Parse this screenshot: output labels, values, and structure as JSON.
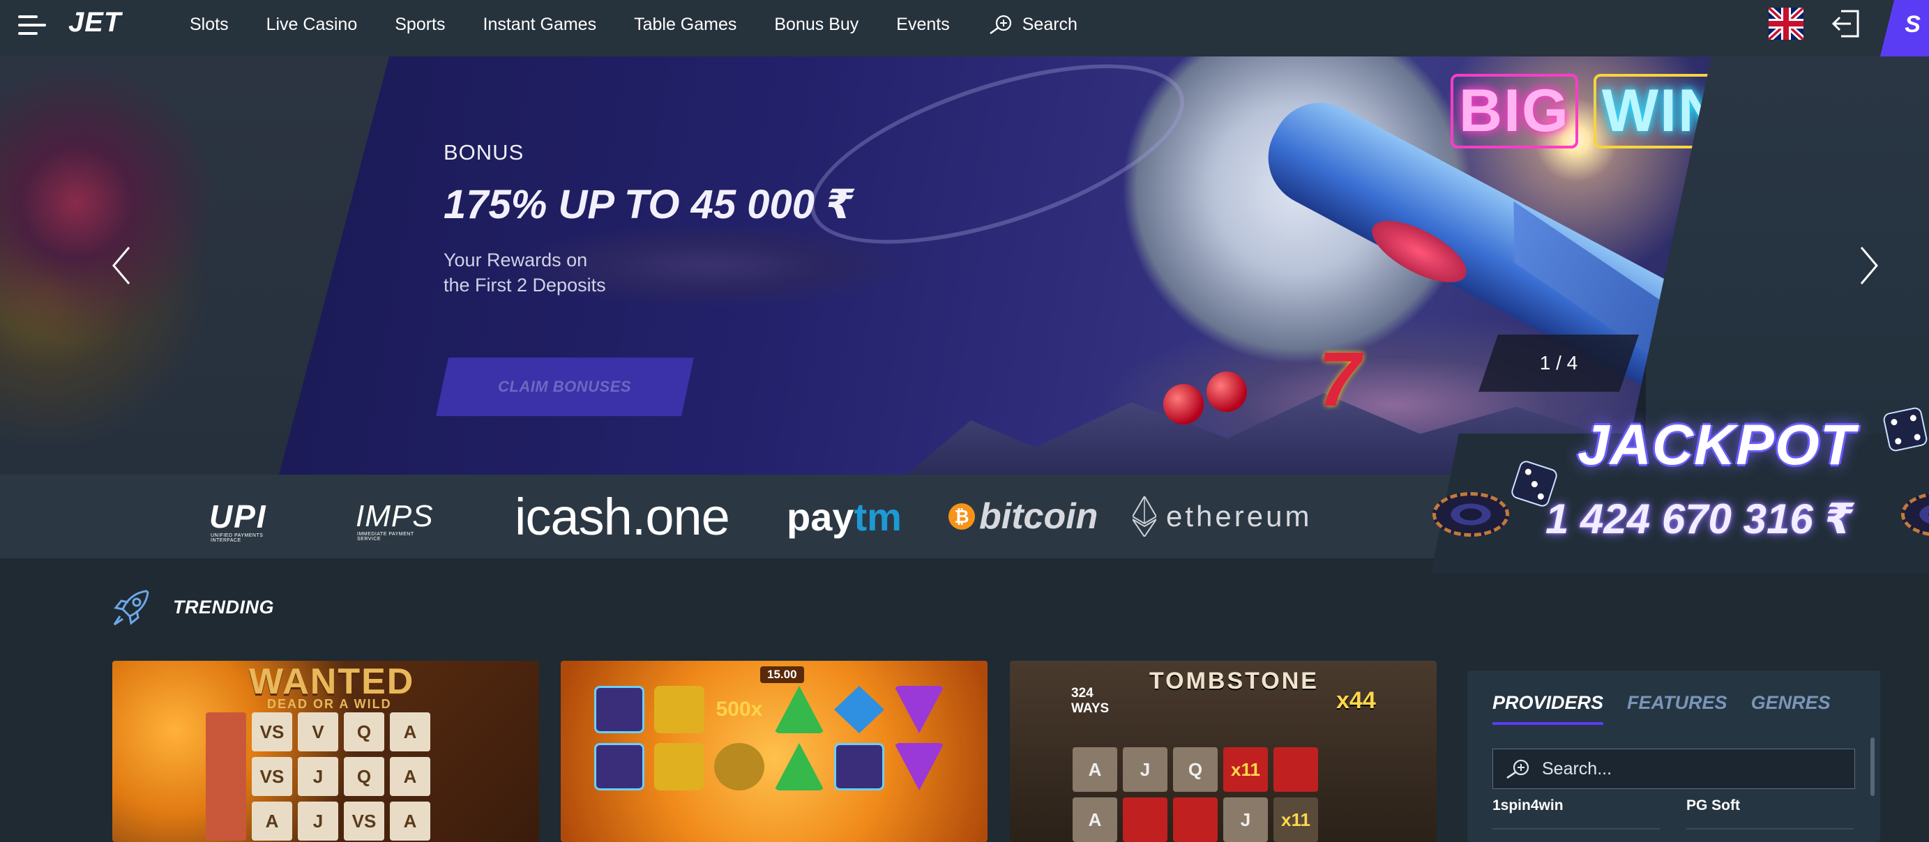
{
  "header": {
    "logo": "JET",
    "nav": [
      "Slots",
      "Live Casino",
      "Sports",
      "Instant Games",
      "Table Games",
      "Bonus Buy",
      "Events"
    ],
    "search_label": "Search",
    "signup_stub": "S"
  },
  "hero": {
    "bonus_label": "BONUS",
    "title": "175% UP TO 45 000 ₹",
    "subtitle_line1": "Your Rewards on",
    "subtitle_line2": "the First 2 Deposits",
    "cta": "CLAIM BONUSES",
    "counter": "1 / 4",
    "big": "BIG",
    "win": "WIN",
    "seven": "7"
  },
  "payments": {
    "upi": "UPI",
    "upi_tag": "UNIFIED PAYMENTS INTERFACE",
    "imps": "IMPS",
    "imps_tag": "IMMEDIATE PAYMENT SERVICE",
    "icash_main": "icash",
    "icash_dot": ".one",
    "paytm_pay": "pay",
    "paytm_tm": "tm",
    "bitcoin": "bitcoin",
    "bitcoin_symbol": "₿",
    "ethereum": "ethereum"
  },
  "jackpot": {
    "title": "JACKPOT",
    "amount": "1 424 670 316 ₹"
  },
  "trending": {
    "label": "TRENDING",
    "cards": [
      {
        "title": "WANTED",
        "subtitle": "DEAD OR A WILD"
      },
      {
        "title": "15.00",
        "multiplier": "500x"
      },
      {
        "title": "TOMBSTONE",
        "ways": "324 WAYS",
        "multiplier": "x44",
        "mult2": "x11"
      }
    ]
  },
  "providers": {
    "tabs": [
      "PROVIDERS",
      "FEATURES",
      "GENRES"
    ],
    "search_placeholder": "Search...",
    "items": [
      "1spin4win",
      "PG Soft"
    ]
  },
  "colors": {
    "accent": "#5b3cf5",
    "topbar": "#26323c",
    "page_bg": "#1f2a33",
    "jackpot_glow": "#7d6aff"
  }
}
